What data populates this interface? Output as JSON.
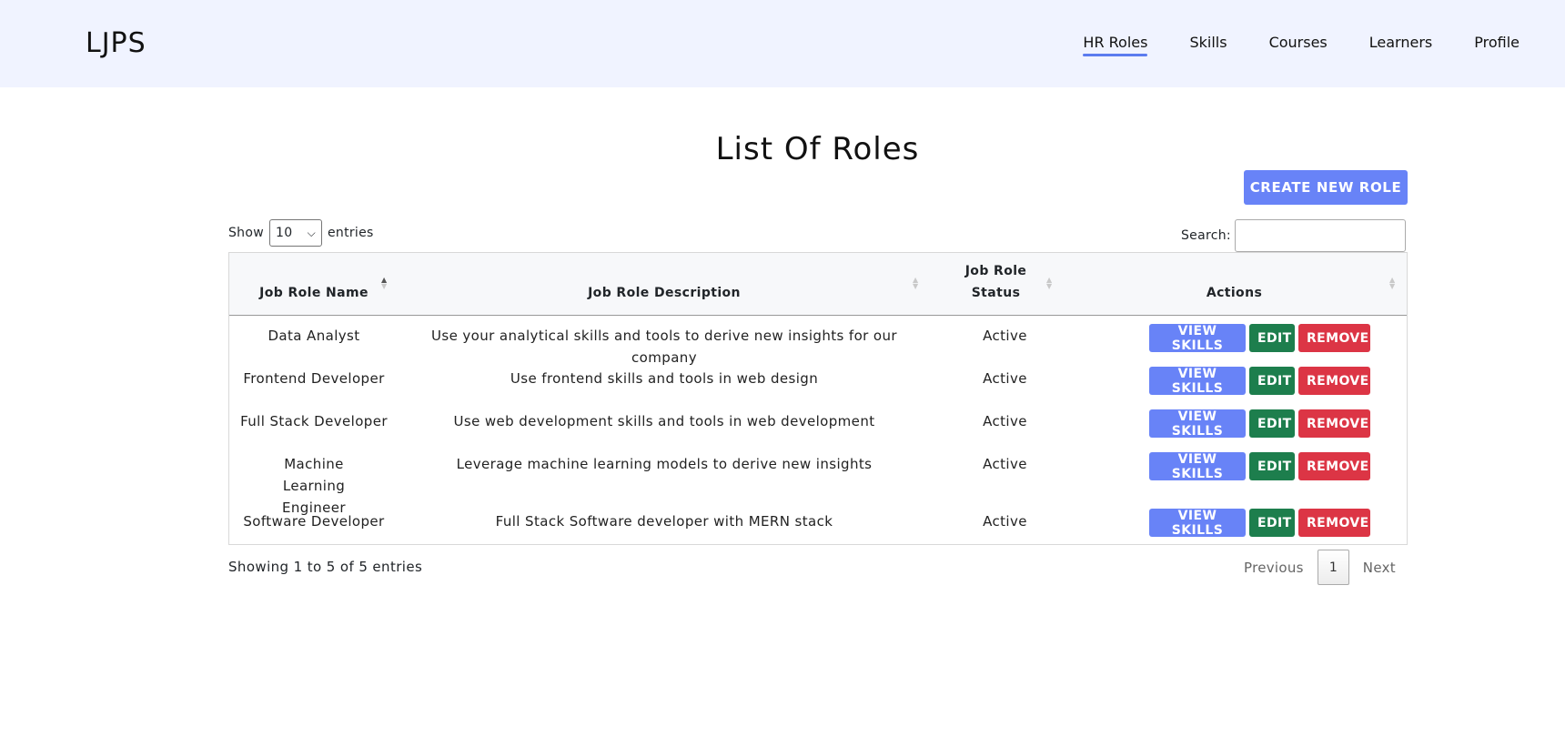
{
  "brand": "LJPS",
  "nav": {
    "items": [
      {
        "label": "HR Roles",
        "active": true
      },
      {
        "label": "Skills"
      },
      {
        "label": "Courses"
      },
      {
        "label": "Learners"
      },
      {
        "label": "Profile"
      }
    ]
  },
  "page_title": "List Of Roles",
  "create_button": "CREATE NEW ROLE",
  "length": {
    "show": "Show",
    "value": "10",
    "entries": "entries"
  },
  "search": {
    "label": "Search:",
    "value": ""
  },
  "table": {
    "headers": [
      "Job Role Name",
      "Job Role Description",
      "Job Role Status",
      "Actions"
    ],
    "rows": [
      {
        "name": "Data Analyst",
        "description": "Use your analytical skills and tools to derive new insights for our company",
        "status": "Active"
      },
      {
        "name": "Frontend Developer",
        "description": "Use frontend skills and tools in web design",
        "status": "Active"
      },
      {
        "name": "Full Stack Developer",
        "description": "Use web development skills and tools in web development",
        "status": "Active"
      },
      {
        "name": "Machine Learning Engineer",
        "description": "Leverage machine learning models to derive new insights",
        "status": "Active"
      },
      {
        "name": "Software Developer",
        "description": "Full Stack Software developer with MERN stack",
        "status": "Active"
      }
    ],
    "action_labels": {
      "view": "VIEW SKILLS",
      "edit": "EDIT",
      "remove": "REMOVE"
    }
  },
  "info": "Showing 1 to 5 of 5 entries",
  "pagination": {
    "previous": "Previous",
    "page": "1",
    "next": "Next"
  },
  "colors": {
    "accent": "#6883f7",
    "edit": "#1d7e4d",
    "remove": "#dc3545",
    "navbar_bg": "#f0f3ff"
  }
}
